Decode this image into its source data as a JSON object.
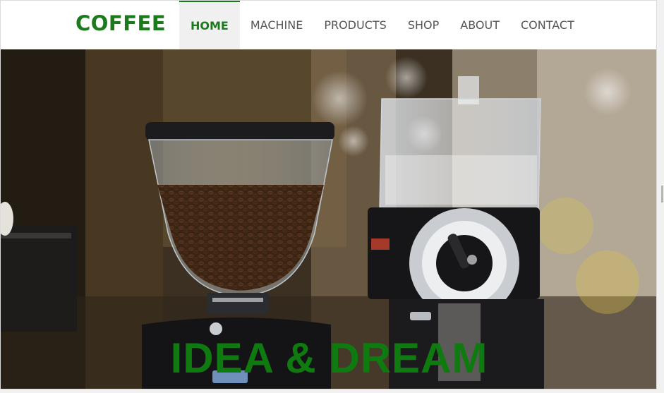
{
  "brand": "COFFEE",
  "nav": [
    {
      "label": "HOME",
      "active": true
    },
    {
      "label": "MACHINE",
      "active": false
    },
    {
      "label": "PRODUCTS",
      "active": false
    },
    {
      "label": "SHOP",
      "active": false
    },
    {
      "label": "ABOUT",
      "active": false
    },
    {
      "label": "CONTACT",
      "active": false
    }
  ],
  "hero": {
    "caption": "IDEA & DREAM",
    "image": "coffee-grinders-photo"
  },
  "colors": {
    "brand": "#1b7a1b",
    "caption": "#0f7a0f",
    "nav_text": "#555555",
    "active_tab_bg": "#f0f0f0"
  }
}
